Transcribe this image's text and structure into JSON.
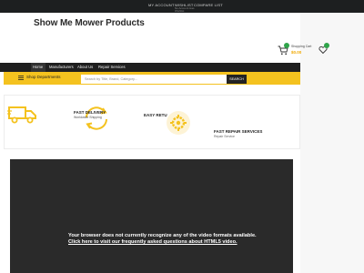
{
  "topbar": {
    "links": [
      "MY ACCOUNT",
      "WISHLIST",
      "COMPARE LIST"
    ],
    "wishlist_note": "No Account Has Wishlist"
  },
  "header": {
    "site_title": "Show Me Mower Products",
    "cart_label": "Shopping Cart",
    "cart_total": "$0.00"
  },
  "nav": {
    "items": [
      "Home",
      "Manufacturers",
      "About Us",
      "Repair Services"
    ]
  },
  "search": {
    "departments_label": "Shop Departments",
    "placeholder": "Search by Title, Brand, Category...",
    "button_label": "SEARCH"
  },
  "features": [
    {
      "title": "",
      "subtitle": ""
    },
    {
      "title": "FAST DELIVERY",
      "subtitle": "Worldwide Shipping"
    },
    {
      "title": "EASY RETU",
      "subtitle": ""
    },
    {
      "title": "FAST REPAIR SERVICES",
      "subtitle": "Repair Service"
    }
  ],
  "video": {
    "message": "Your browser does not currently recognize any of the video formats available.",
    "link_text": "Click here to visit our frequently asked questions about HTML5 video."
  },
  "colors": {
    "accent": "#f4c21f",
    "dark": "#1f1f1f",
    "badge": "#2fa44a"
  }
}
